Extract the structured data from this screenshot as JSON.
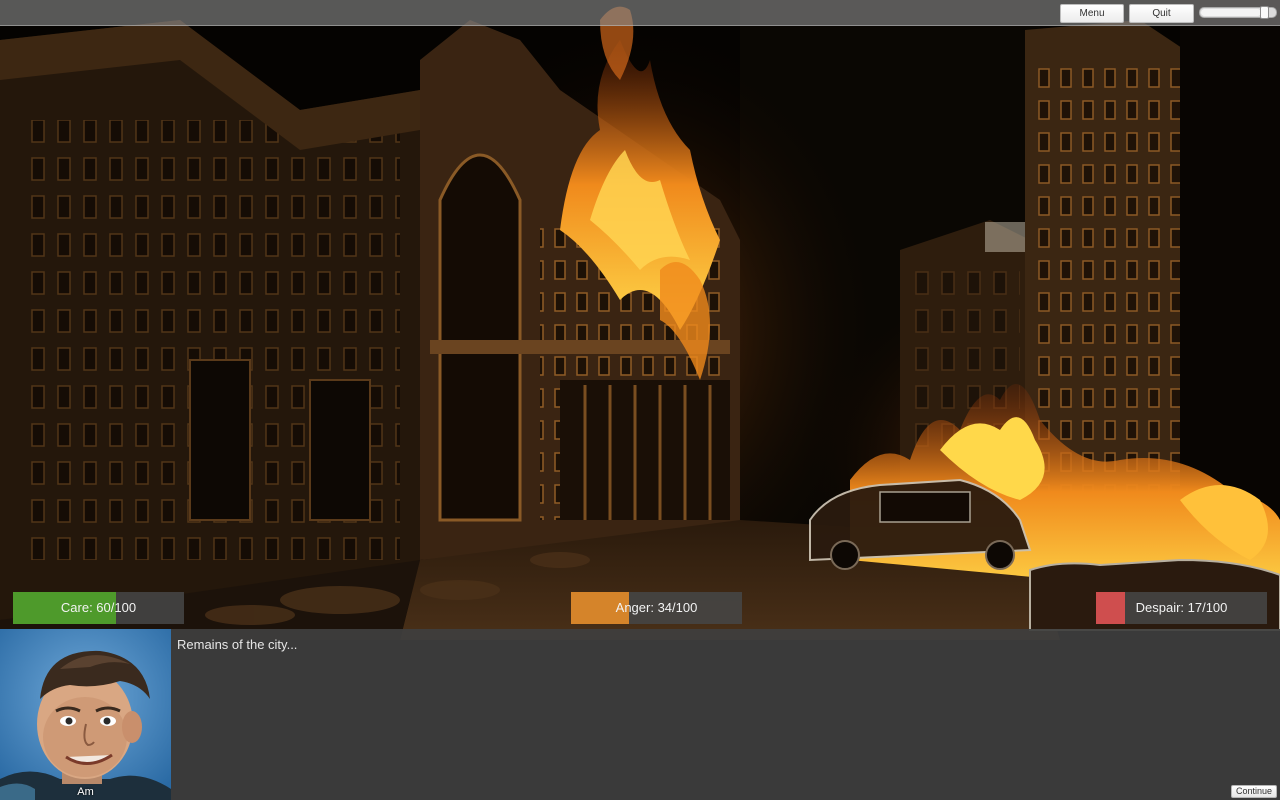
{
  "topbar": {
    "menu_label": "Menu",
    "quit_label": "Quit",
    "volume_level": 0.9
  },
  "stats": {
    "care": {
      "label": "Care:  60/100",
      "value": 60,
      "max": 100,
      "color": "#4e9a2b"
    },
    "anger": {
      "label": "Anger:  34/100",
      "value": 34,
      "max": 100,
      "color": "#d5842a"
    },
    "despair": {
      "label": "Despair:  17/100",
      "value": 17,
      "max": 100,
      "color": "#cf4e4e"
    }
  },
  "dialogue": {
    "speaker": "Am",
    "text": "Remains of the city...",
    "continue_label": "Continue"
  },
  "colors": {
    "fire_bright": "#ffcb3a",
    "fire_mid": "#ef7a16",
    "fire_dark": "#b8400c",
    "building": "#3a2512"
  }
}
